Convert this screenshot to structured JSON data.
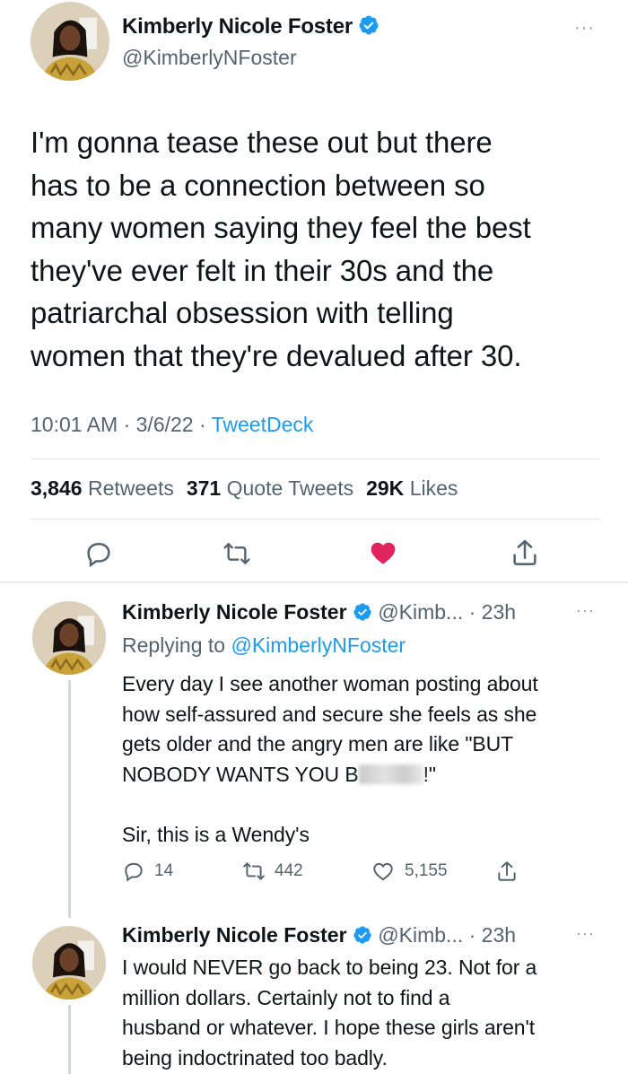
{
  "main_tweet": {
    "author_name": "Kimberly Nicole Foster",
    "handle": "@KimberlyNFoster",
    "more": "···",
    "text_lines": [
      "I'm gonna tease these out but there",
      "has to be a connection between so",
      "many women saying they feel the best",
      "they've ever felt in their 30s and the",
      "patriarchal obsession with telling",
      "women that they're devalued after 30."
    ],
    "time": "10:01 AM",
    "date": "3/6/22",
    "separator": " · ",
    "source": "TweetDeck",
    "stats": {
      "retweets_count": "3,846",
      "retweets_label": "Retweets",
      "quotes_count": "371",
      "quotes_label": "Quote Tweets",
      "likes_count": "29K",
      "likes_label": "Likes"
    }
  },
  "replies": [
    {
      "author_name": "Kimberly Nicole Foster",
      "handle": "@Kimb...",
      "time": "· 23h",
      "more": "···",
      "replying_prefix": "Replying to",
      "replying_to": "@KimberlyNFoster",
      "text_lines": [
        "Every day I see another woman posting about",
        "how self-assured and secure she feels as she",
        "gets older and the angry men are like \"BUT"
      ],
      "line4_before": "NOBODY WANTS YOU B",
      "line4_after": "!\"",
      "line5": "Sir, this is a Wendy's",
      "actions": {
        "replies": "14",
        "retweets": "442",
        "likes": "5,155"
      }
    },
    {
      "author_name": "Kimberly Nicole Foster",
      "handle": "@Kimb...",
      "time": "· 23h",
      "more": "···",
      "text_lines": [
        "I would NEVER go back to being 23. Not for a",
        "million dollars. Certainly not to find a",
        "husband or whatever. I hope these girls aren't",
        "being indoctrinated too badly."
      ]
    }
  ],
  "colors": {
    "link": "#1d9bf0",
    "like_active": "#e0245e",
    "secondary_text": "#536471",
    "verified": "#1d9bf0"
  },
  "icons": [
    "reply-icon",
    "retweet-icon",
    "heart-icon",
    "share-icon",
    "verified-badge-icon",
    "more-icon"
  ]
}
